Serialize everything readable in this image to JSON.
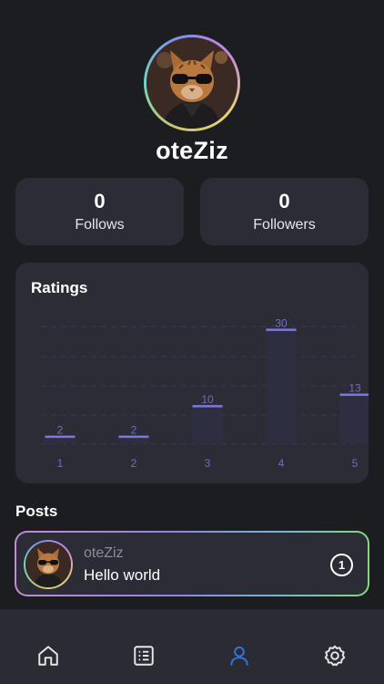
{
  "profile": {
    "username": "oteZiz"
  },
  "stats": {
    "follows": {
      "value": "0",
      "label": "Follows"
    },
    "followers": {
      "value": "0",
      "label": "Followers"
    }
  },
  "ratings": {
    "title": "Ratings"
  },
  "chart_data": {
    "type": "bar",
    "title": "Ratings",
    "categories": [
      "1",
      "2",
      "3",
      "4",
      "5"
    ],
    "values": [
      2,
      2,
      10,
      30,
      13
    ],
    "ylim": [
      0,
      32
    ],
    "grid": true,
    "colors": {
      "bar": "#2d2f40",
      "cap": "#7b79e0",
      "label": "#6f6cc8",
      "grid": "#3b3d4a"
    }
  },
  "posts": {
    "title": "Posts",
    "items": [
      {
        "author": "oteZiz",
        "text": "Hello world",
        "badge": "1"
      }
    ]
  },
  "nav": {
    "items": [
      {
        "icon": "home-icon",
        "active": false
      },
      {
        "icon": "list-icon",
        "active": false
      },
      {
        "icon": "profile-icon",
        "active": true
      },
      {
        "icon": "settings-icon",
        "active": false
      }
    ],
    "active_color": "#2f74e6",
    "inactive_color": "#e6e6ea"
  }
}
